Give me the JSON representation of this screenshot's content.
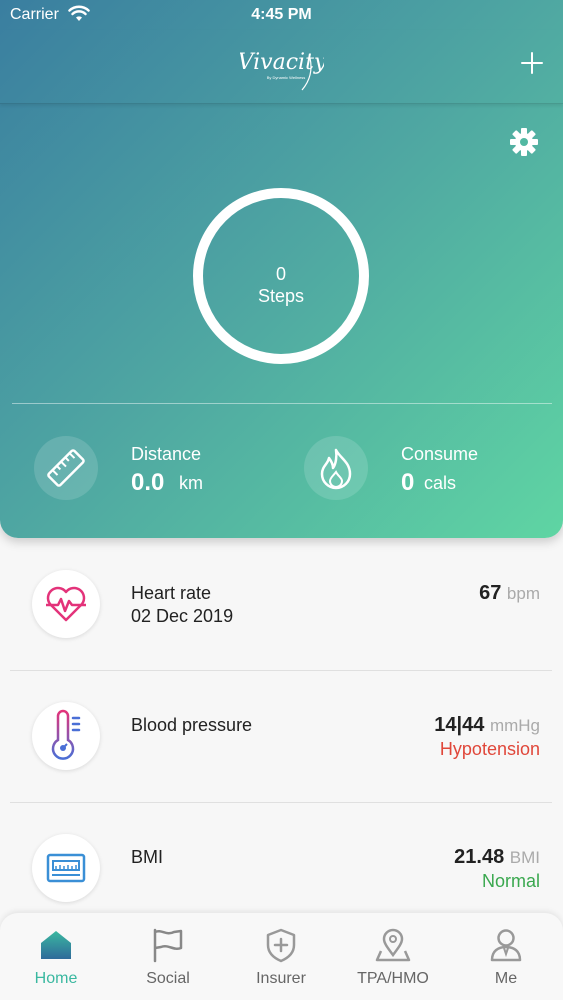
{
  "status_bar": {
    "carrier": "Carrier",
    "time": "4:45 PM"
  },
  "header": {
    "logo_text": "Vivacity",
    "logo_tagline": "By Dynamic Wellness"
  },
  "steps": {
    "value": "0",
    "label": "Steps"
  },
  "stats": {
    "distance": {
      "label": "Distance",
      "value": "0.0",
      "unit": "km"
    },
    "consume": {
      "label": "Consume",
      "value": "0",
      "unit": "cals"
    }
  },
  "metrics": [
    {
      "title": "Heart rate",
      "subtitle": "02 Dec 2019",
      "value": "67",
      "unit": "bpm",
      "status": ""
    },
    {
      "title": "Blood pressure",
      "subtitle": "",
      "value": "14|44",
      "unit": "mmHg",
      "status": "Hypotension",
      "status_color": "#e0473a"
    },
    {
      "title": "BMI",
      "subtitle": "",
      "value": "21.48",
      "unit": "BMI",
      "status": "Normal",
      "status_color": "#3aa84f"
    }
  ],
  "tabs": [
    {
      "label": "Home",
      "icon": "home-icon",
      "active": true
    },
    {
      "label": "Social",
      "icon": "flag-icon",
      "active": false
    },
    {
      "label": "Insurer",
      "icon": "shield-plus-icon",
      "active": false
    },
    {
      "label": "TPA/HMO",
      "icon": "map-pin-icon",
      "active": false
    },
    {
      "label": "Me",
      "icon": "person-icon",
      "active": false
    }
  ],
  "colors": {
    "accent": "#3ab8a0",
    "hero_start": "#3a7ea0",
    "hero_end": "#5fd5a3"
  }
}
